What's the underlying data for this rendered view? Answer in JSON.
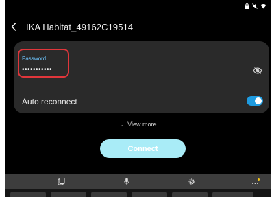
{
  "header": {
    "title": "IKA Habitat_49162C19514"
  },
  "password": {
    "label": "Password",
    "value": "•••••••••••"
  },
  "auto_reconnect": {
    "label": "Auto reconnect",
    "enabled": true
  },
  "view_more": {
    "label": "View more"
  },
  "connect": {
    "label": "Connect"
  },
  "icons": {
    "back": "chevron-left-icon",
    "eye": "eye-off-icon",
    "clipboard": "clipboard-icon",
    "mic": "microphone-icon",
    "settings": "gear-icon",
    "more": "more-dots-icon"
  },
  "colors": {
    "accent": "#1e9be0",
    "label_blue": "#6ec6ff",
    "highlight": "#e0363b",
    "connect_bg": "#a9ecf7"
  }
}
